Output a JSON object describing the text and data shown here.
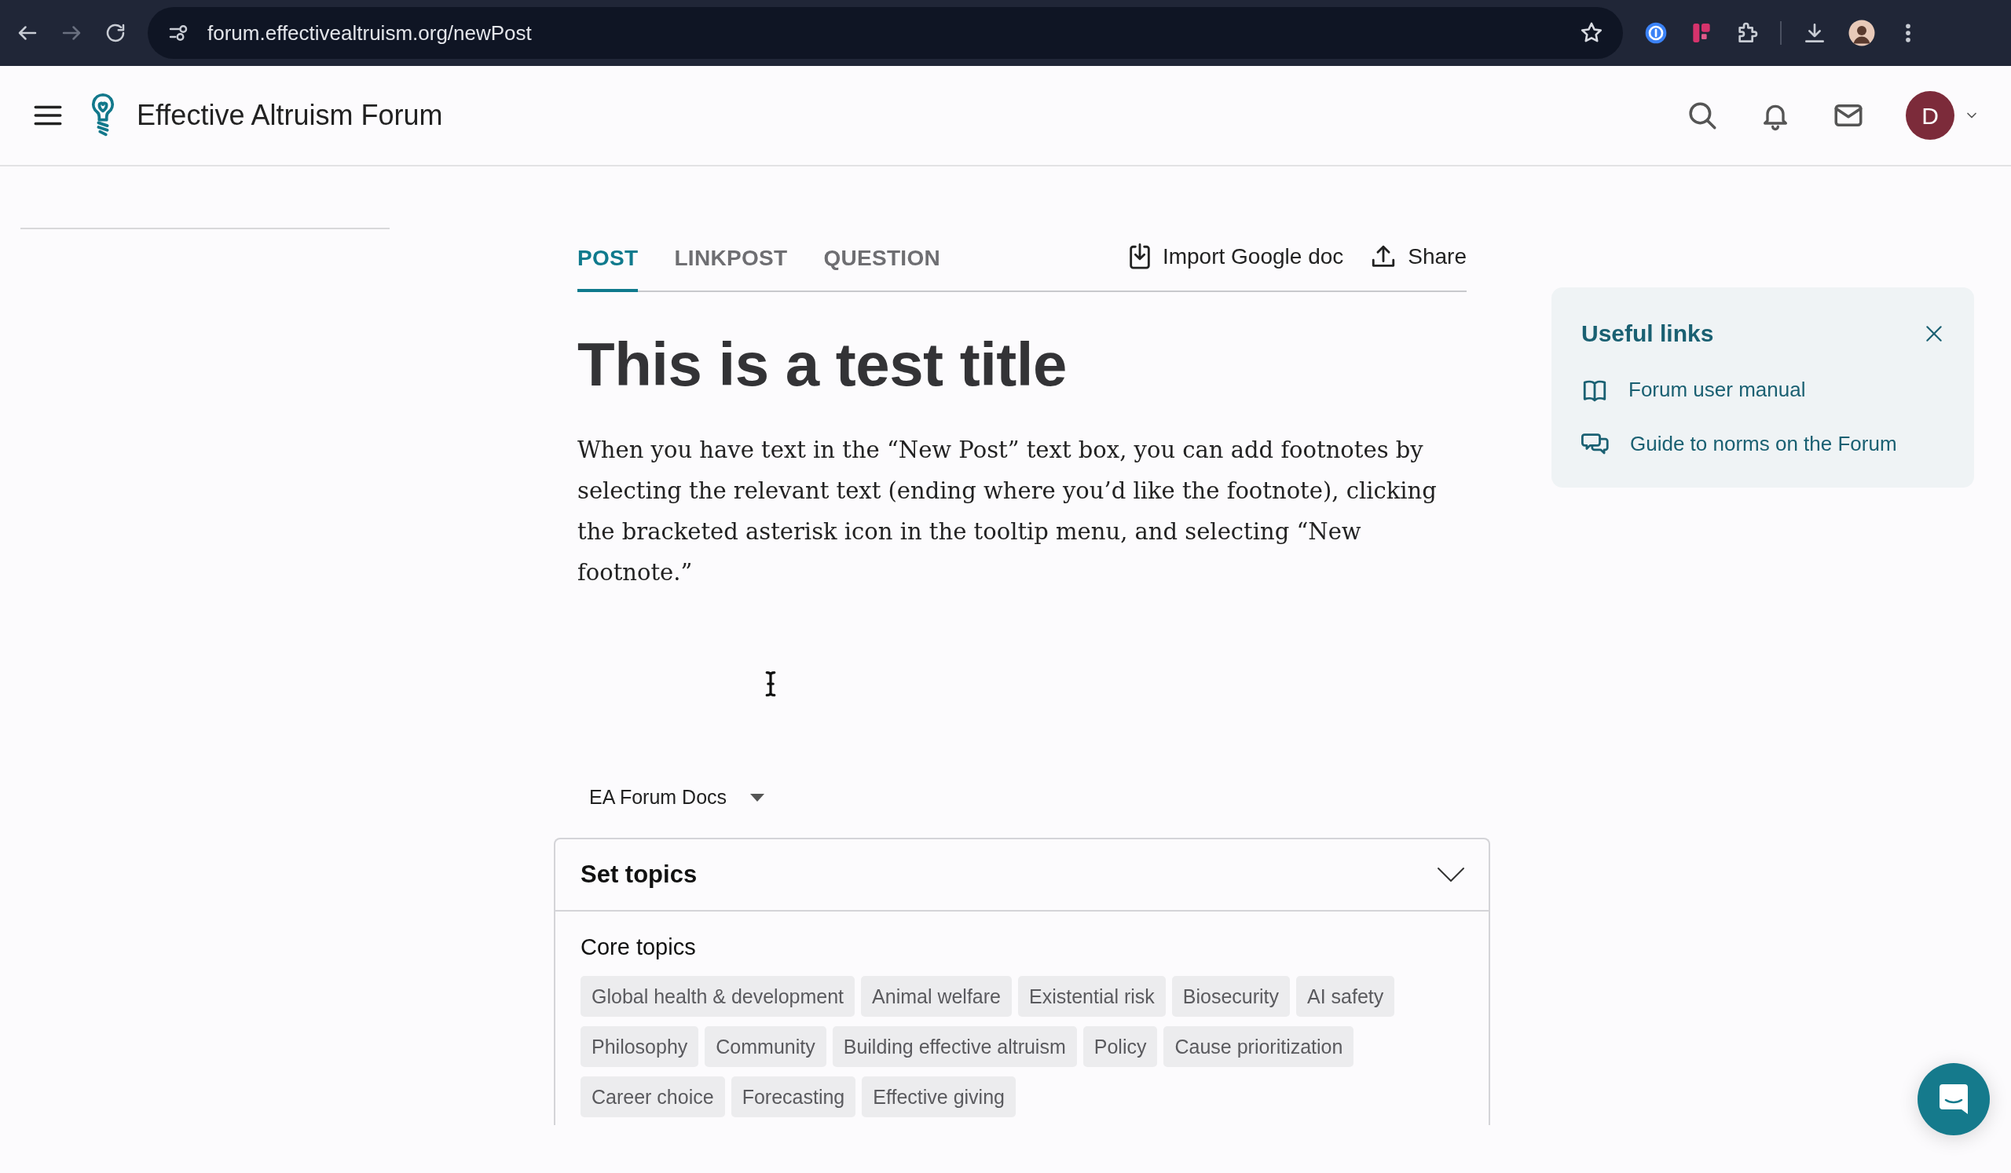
{
  "browser": {
    "url": "forum.effectivealtruism.org/newPost"
  },
  "header": {
    "site_title": "Effective Altruism Forum",
    "avatar_initial": "D"
  },
  "editor": {
    "tabs": [
      {
        "label": "POST",
        "selected": true
      },
      {
        "label": "LINKPOST",
        "selected": false
      },
      {
        "label": "QUESTION",
        "selected": false
      }
    ],
    "actions": [
      {
        "label": "Import Google doc",
        "kind": "import"
      },
      {
        "label": "Share",
        "kind": "share"
      }
    ],
    "title": "This is a test title",
    "body": "When you have text in the “New Post” text box, you can add footnotes by selecting the relevant text (ending where you’d like the footnote), clicking the bracketed asterisk icon in the tooltip menu, and selecting “New footnote.”"
  },
  "collection": {
    "label": "EA Forum Docs"
  },
  "topics": {
    "title": "Set topics",
    "section_heading": "Core topics",
    "tags": [
      "Global health & development",
      "Animal welfare",
      "Existential risk",
      "Biosecurity",
      "AI safety",
      "Philosophy",
      "Community",
      "Building effective altruism",
      "Policy",
      "Cause prioritization",
      "Career choice",
      "Forecasting",
      "Effective giving"
    ]
  },
  "useful_links": {
    "title": "Useful links",
    "links": [
      {
        "label": "Forum user manual",
        "kind": "manual"
      },
      {
        "label": "Guide to norms on the Forum",
        "kind": "guide"
      }
    ]
  }
}
